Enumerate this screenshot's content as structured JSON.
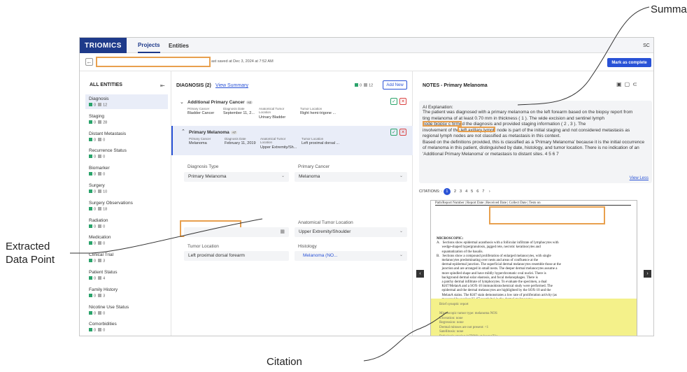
{
  "annotations": {
    "summary": "Summary",
    "extracted": [
      "Extracted",
      "Data Point"
    ],
    "citation": "Citation"
  },
  "nav": {
    "brand": "TRIOMICS",
    "tabs": [
      "Projects",
      "Entities"
    ],
    "avatar": "SC"
  },
  "toolbar": {
    "saved_text": "ast saved at Dec 3, 2024 at 7:52 AM",
    "complete_label": "Mark as complete"
  },
  "sidebar": {
    "header": "ALL ENTITIES",
    "items": [
      {
        "label": "Diagnosis",
        "green": "0",
        "gray": "12"
      },
      {
        "label": "Staging",
        "green": "0",
        "gray": "28"
      },
      {
        "label": "Distant Metastasis",
        "green": "0",
        "gray": "0"
      },
      {
        "label": "Recurrence Status",
        "green": "0",
        "gray": "0"
      },
      {
        "label": "Biomarker",
        "green": "0",
        "gray": "0"
      },
      {
        "label": "Surgery",
        "green": "0",
        "gray": "10"
      },
      {
        "label": "Surgery Observations",
        "green": "0",
        "gray": "18"
      },
      {
        "label": "Radiation",
        "green": "0",
        "gray": "0"
      },
      {
        "label": "Medication",
        "green": "0",
        "gray": "0"
      },
      {
        "label": "Clinical Trial",
        "green": "0",
        "gray": "3"
      },
      {
        "label": "Patient Status",
        "green": "0",
        "gray": "4"
      },
      {
        "label": "Family History",
        "green": "0",
        "gray": "3"
      },
      {
        "label": "Nicotine Use Status",
        "green": "0",
        "gray": "0"
      },
      {
        "label": "Comorbidities",
        "green": "0",
        "gray": "0"
      }
    ]
  },
  "diagnosis": {
    "title": "DIAGNOSIS (2)",
    "view_summary": "View Summary",
    "green": "0",
    "gray": "12",
    "add_new": "Add New",
    "cards": [
      {
        "name": "Additional Primary Cancer",
        "badge": "+4",
        "cancer": "Bladder Cancer",
        "date": "September 11, 2...",
        "loc": "Urinary Bladder",
        "tumor_loc": "Right hemi-trigone ..."
      },
      {
        "name": "Primary Melanoma",
        "badge": "+7",
        "cancer": "Melanoma",
        "date": "February 11, 2019",
        "loc": "Upper Extremity/Sh...",
        "tumor_loc": "Left proximal dorsal ..."
      }
    ],
    "col_labels": {
      "cancer": "Primary Cancer",
      "date": "Diagnosis Date",
      "loc": "Anatomical Tumor Location",
      "tumor_loc": "Tumor Location"
    },
    "form": {
      "diag_type_label": "Diagnosis Type",
      "diag_type_value": "Primary Melanoma",
      "primary_cancer_label": "Primary Cancer",
      "primary_cancer_value": "Melanoma",
      "anat_label": "Anatomical Tumor Location",
      "anat_value": "Upper Extremity/Shoulder",
      "tumor_loc_label": "Tumor Location",
      "tumor_loc_value": "Left proximal dorsal forearm",
      "histology_label": "Histology",
      "histology_value": "Melanoma (NO..."
    }
  },
  "notes": {
    "title": "NOTES - Primary Melanoma",
    "ai_head": "AI Explanation:",
    "ai_lines": [
      "The patient was diagnosed with a primary melanoma on the left forearm based on the biopsy report from",
      "                  ting melanoma of at least 0.70 mm in thickness ( 1 ). The wide excision and sentinel lymph",
      "node biopsy c                  firmed the diagnosis and provided staging information ( 2 , 3 ). The",
      "involvement of the left axillary lymph node is part of the initial staging and not considered metastasis as",
      "regional lymph nodes are not classified as metastasis in this context.",
      "Based on the definitions provided, this is classified as a 'Primary Melanoma' because it is the initial occurrence",
      "of melanoma in this patient, distinguished by date, histology, and tumor location. There is no indication of an",
      "'Additional Primary Melanoma' or metastasis to distant sites. 4 5 6 7"
    ],
    "view_less": "View Less",
    "citations_label": "CITATIONS:",
    "citation_pages": [
      "1",
      "2",
      "3",
      "4",
      "5",
      "6",
      "7"
    ]
  },
  "document": {
    "header": "Path/Report Number  |  Report Date  |  Received Date  |  Collect Date  |  Tests on",
    "micro_lines": [
      "MICROSCOPIC:",
      "A.   Sections show epidermal acanthosis with a follicular infiltrate of lymphocytes with",
      "      wedge-shaped hypergranulosis, jagged rete, necrotic keratinocytes and",
      "      squamatization of the basalis.",
      "B.   Sections show a compound proliferation of enlarged melanocytes, with single",
      "      melanocytes predominating over nests and areas of confluence at the",
      "      dermal-epidermal junction. The superficial dermal melanocytes resemble those at the",
      "      junction and are arranged in small nests. The deeper dermal melanocytes assume a",
      "      more spindled shape and have mildly hyperchromatic oval nuclei. There is",
      "      background dermal solar elastosis, and focal melanophages. There is",
      "      a patchy dermal infiltrate of lymphocytes. To evaluate the specimen, a dual",
      "      Ki67/MelanA and a SOX-10 immunohistochemical study were performed. The",
      "      epidermal and the dermal melanocytes are highlighted by the SOX-10 and the",
      "      MelanA stains. The Ki67 stain demonstrates a low rate of proliferation activity (as",
      "      measured by nuclear Ki-67 reactivity) in the dermal melanocytes.",
      "      Immunohistochemical studies were performed with appropriate controls. The",
      "      USFDA has not approved this test, but FDA approval is not required for clinical use.",
      "      All controls show appropriate reactivity."
    ],
    "synoptic_lines": [
      "Brief synoptic report",
      "",
      "Microscopic tumor type: melanoma NOS",
      "Ulceration: none",
      "Regression: none",
      "Dermal mitoses are not present: <1",
      "Satellitosis: none",
      "Pathologic staging (pTNM): at least pT1a"
    ]
  }
}
